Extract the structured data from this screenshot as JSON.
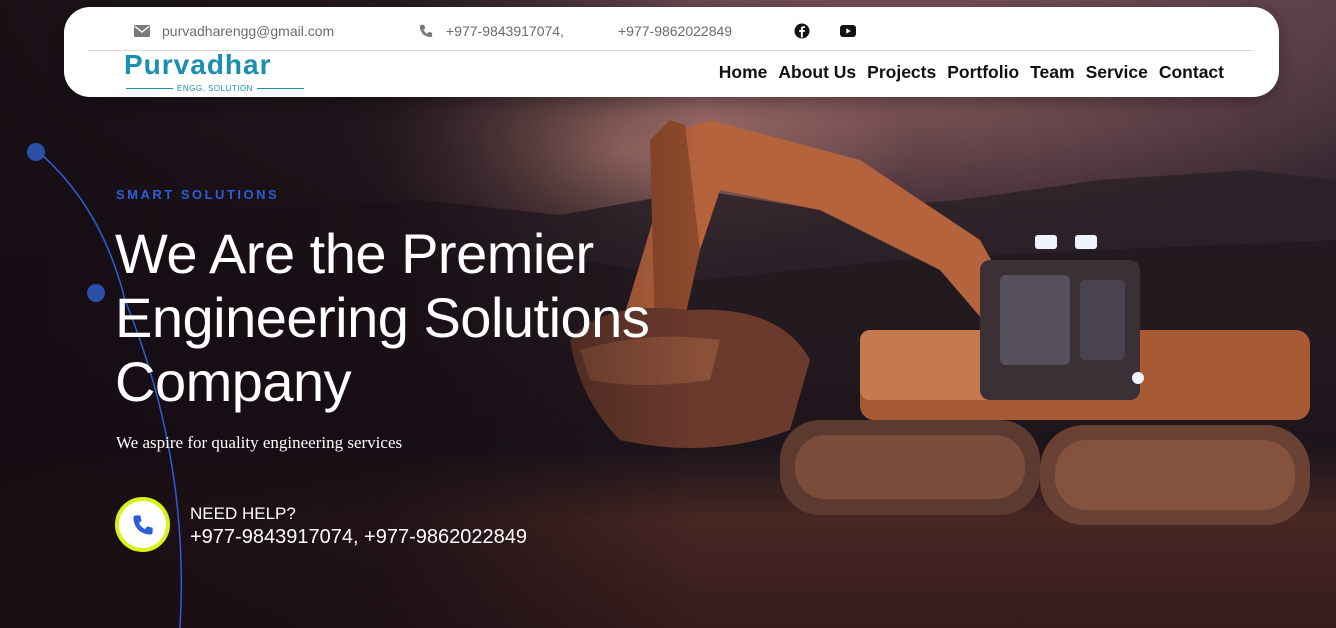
{
  "topbar": {
    "email": "purvadharengg@gmail.com",
    "phone1": "+977-9843917074,",
    "phone2": "+977-9862022849",
    "icons": [
      "envelope-icon",
      "phone-icon",
      "facebook-icon",
      "youtube-icon"
    ]
  },
  "brand": {
    "name": "Purvadhar",
    "tagline": "ENGG. SOLUTION",
    "color": "#1a8fb0"
  },
  "nav": {
    "items": [
      "Home",
      "About Us",
      "Projects",
      "Portfolio",
      "Team",
      "Service",
      "Contact"
    ]
  },
  "hero": {
    "eyebrow": "SMART SOLUTIONS",
    "headline": "We Are the Premier Engineering Solutions Company",
    "subtitle": "We aspire for quality engineering services",
    "help_title": "NEED HELP?",
    "help_phones": "+977-9843917074, +977-9862022849",
    "accent": "#2c5fd6",
    "ring_color": "#d8f21c"
  }
}
